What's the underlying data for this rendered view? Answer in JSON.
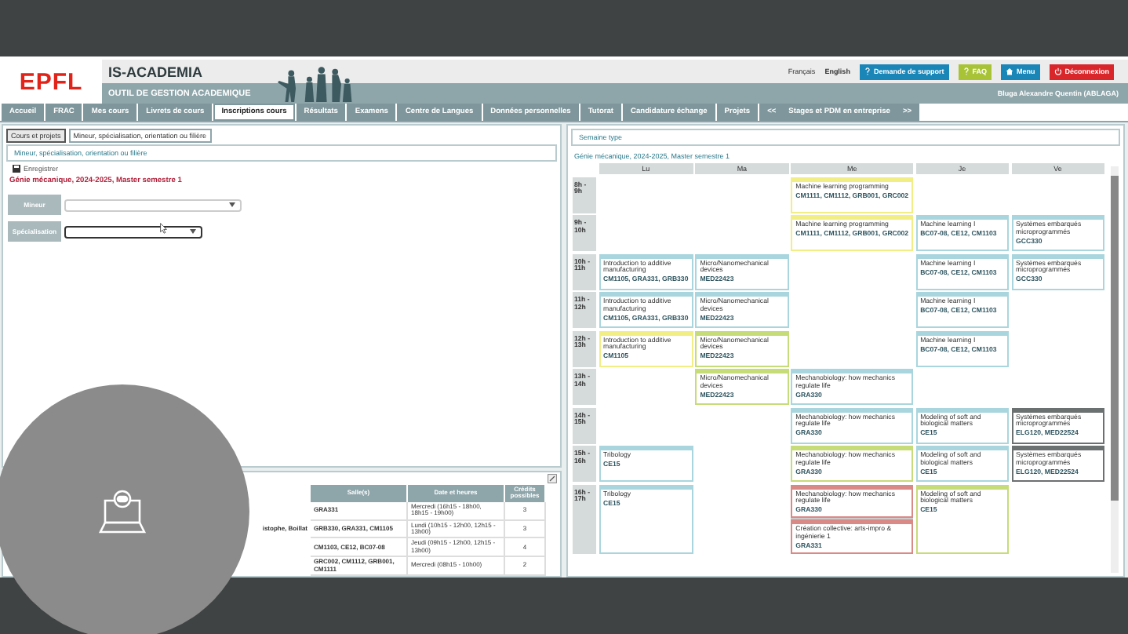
{
  "header": {
    "logo": "EPFL",
    "title": "IS-ACADEMIA",
    "subtitle": "OUTIL DE GESTION ACADEMIQUE",
    "languages": [
      {
        "label": "Français",
        "selected": false
      },
      {
        "label": "English",
        "selected": true
      }
    ],
    "buttons": [
      {
        "label": "Demande de support",
        "kind": "support"
      },
      {
        "label": "FAQ",
        "kind": "faq"
      },
      {
        "label": "Menu",
        "kind": "menu"
      },
      {
        "label": "Déconnexion",
        "kind": "logout"
      }
    ],
    "user": "Bluga Alexandre Quentin (ABLAGA)"
  },
  "main_tabs": [
    {
      "label": "Accueil",
      "selected": false
    },
    {
      "label": "FRAC",
      "selected": false
    },
    {
      "label": "Mes cours",
      "selected": false
    },
    {
      "label": "Livrets de cours",
      "selected": false
    },
    {
      "label": "Inscriptions cours",
      "selected": true
    },
    {
      "label": "Résultats",
      "selected": false
    },
    {
      "label": "Examens",
      "selected": false
    },
    {
      "label": "Centre de Langues",
      "selected": false
    },
    {
      "label": "Données personnelles",
      "selected": false
    },
    {
      "label": "Tutorat",
      "selected": false
    },
    {
      "label": "Candidature échange",
      "selected": false
    },
    {
      "label": "Projets",
      "selected": false
    },
    {
      "label": "Stages et PDM en entreprise",
      "selected": false
    }
  ],
  "tab_scroll": {
    "previous": "<<",
    "next": ">>"
  },
  "left_panel": {
    "sub_tabs": [
      {
        "label": "Cours et projets",
        "selected": false
      },
      {
        "label": "Mineur, spécialisation, orientation ou filière",
        "selected": true
      }
    ],
    "section_title": "Mineur, spécialisation, orientation ou filière",
    "save": "Enregistrer",
    "program": "Génie mécanique, 2024-2025, Master semestre 1",
    "fields": [
      {
        "label": "Mineur",
        "focused": false
      },
      {
        "label": "Spécialisation",
        "focused": true
      }
    ]
  },
  "courses_table": {
    "columns": [
      "Salle(s)",
      "Date et heures",
      "Crédits possibles"
    ],
    "rows": [
      {
        "rooms": "GRA331",
        "schedule": "Mercredi (16h15 - 18h00, 18h15 - 19h00)",
        "credits": "3"
      },
      {
        "column_1": "istophe, Boillat",
        "rooms": "GRB330, GRA331, CM1105",
        "schedule": "Lundi (10h15 - 12h00, 12h15 - 13h00)",
        "credits": "3"
      },
      {
        "rooms": "CM1103, CE12, BC07-08",
        "schedule": "Jeudi (09h15 - 12h00, 12h15 - 13h00)",
        "credits": "4"
      },
      {
        "rooms": "GRC002, CM1112, GRB001, CM1111",
        "schedule": "Mercredi (08h15 - 10h00)",
        "credits": "2"
      }
    ]
  },
  "schedule": {
    "title": "Semaine type",
    "program": "Génie mécanique, 2024-2025, Master semestre 1",
    "days": [
      "Lu",
      "Ma",
      "Me",
      "Je",
      "Ve"
    ],
    "rows": [
      {
        "time": "8h - 9h",
        "slots": [
          {
            "kind": "free"
          },
          {
            "kind": "free"
          },
          {
            "kind": "course",
            "events": [
              {
                "title": "Machine learning programming",
                "rooms": "CM1111, CM1112, GRB001, GRC002",
                "color": "#f2ee86"
              }
            ]
          },
          {
            "kind": "free"
          },
          {
            "kind": "free"
          }
        ]
      },
      {
        "time": "9h - 10h",
        "slots": [
          {
            "kind": "free"
          },
          {
            "kind": "free"
          },
          {
            "kind": "course",
            "events": [
              {
                "title": "Machine learning programming",
                "rooms": "CM1111, CM1112, GRB001, GRC002",
                "color": "#f2ee86"
              }
            ]
          },
          {
            "kind": "course",
            "events": [
              {
                "title": "Machine learning I",
                "rooms": "BC07-08, CE12, CM1103",
                "color": "#a9d6de"
              }
            ]
          },
          {
            "kind": "course",
            "events": [
              {
                "title": "Systèmes embarqués microprogrammés",
                "rooms": "GCC330",
                "color": "#a9d6de"
              }
            ]
          }
        ]
      },
      {
        "time": "10h - 11h",
        "slots": [
          {
            "kind": "course",
            "events": [
              {
                "title": "Introduction to additive manufacturing",
                "rooms": "CM1105, GRA331, GRB330",
                "color": "#a9d6de"
              }
            ]
          },
          {
            "kind": "course",
            "events": [
              {
                "title": "Micro/Nanomechanical devices",
                "rooms": "MED22423",
                "color": "#a9d6de"
              }
            ]
          },
          {
            "kind": "free"
          },
          {
            "kind": "course",
            "events": [
              {
                "title": "Machine learning I",
                "rooms": "BC07-08, CE12, CM1103",
                "color": "#a9d6de"
              }
            ]
          },
          {
            "kind": "course",
            "events": [
              {
                "title": "Systèmes embarqués microprogrammés",
                "rooms": "GCC330",
                "color": "#a9d6de"
              }
            ]
          }
        ]
      },
      {
        "time": "11h - 12h",
        "slots": [
          {
            "kind": "course",
            "events": [
              {
                "title": "Introduction to additive manufacturing",
                "rooms": "CM1105, GRA331, GRB330",
                "color": "#a9d6de"
              }
            ]
          },
          {
            "kind": "course",
            "events": [
              {
                "title": "Micro/Nanomechanical devices",
                "rooms": "MED22423",
                "color": "#a9d6de"
              }
            ]
          },
          {
            "kind": "free"
          },
          {
            "kind": "course",
            "events": [
              {
                "title": "Machine learning I",
                "rooms": "BC07-08, CE12, CM1103",
                "color": "#a9d6de"
              }
            ]
          },
          {
            "kind": "free"
          }
        ]
      },
      {
        "time": "12h - 13h",
        "slots": [
          {
            "kind": "course",
            "events": [
              {
                "title": "Introduction to additive manufacturing",
                "rooms": "CM1105",
                "color": "#f2ee86"
              }
            ]
          },
          {
            "kind": "course",
            "events": [
              {
                "title": "Micro/Nanomechanical devices",
                "rooms": "MED22423",
                "color": "#c6dc78"
              }
            ]
          },
          {
            "kind": "free"
          },
          {
            "kind": "course",
            "events": [
              {
                "title": "Machine learning I",
                "rooms": "BC07-08, CE12, CM1103",
                "color": "#a9d6de"
              }
            ]
          },
          {
            "kind": "free"
          }
        ]
      },
      {
        "time": "13h - 14h",
        "slots": [
          {
            "kind": "free"
          },
          {
            "kind": "course",
            "events": [
              {
                "title": "Micro/Nanomechanical devices",
                "rooms": "MED22423",
                "color": "#c6dc78"
              }
            ]
          },
          {
            "kind": "course",
            "events": [
              {
                "title": "Mechanobiology: how mechanics regulate life",
                "rooms": "GRA330",
                "color": "#a9d6de"
              }
            ]
          },
          {
            "kind": "free"
          },
          {
            "kind": "free"
          }
        ]
      },
      {
        "time": "14h - 15h",
        "slots": [
          {
            "kind": "free"
          },
          {
            "kind": "free"
          },
          {
            "kind": "course",
            "events": [
              {
                "title": "Mechanobiology: how mechanics regulate life",
                "rooms": "GRA330",
                "color": "#a9d6de"
              }
            ]
          },
          {
            "kind": "course",
            "events": [
              {
                "title": "Modeling of soft and biological matters",
                "rooms": "CE15",
                "color": "#a9d6de"
              }
            ]
          },
          {
            "kind": "course",
            "events": [
              {
                "title": "Systèmes embarqués microprogrammés",
                "rooms": "ELG120, MED22524",
                "color": "#6b7071"
              }
            ]
          }
        ]
      },
      {
        "time": "15h - 16h",
        "slots": [
          {
            "kind": "course",
            "events": [
              {
                "title": "Tribology",
                "rooms": "CE15",
                "color": "#a9d6de"
              }
            ]
          },
          {
            "kind": "free"
          },
          {
            "kind": "course",
            "events": [
              {
                "title": "Mechanobiology: how mechanics regulate life",
                "rooms": "GRA330",
                "color": "#c6dc78"
              }
            ]
          },
          {
            "kind": "course",
            "events": [
              {
                "title": "Modeling of soft and biological matters",
                "rooms": "CE15",
                "color": "#a9d6de"
              }
            ]
          },
          {
            "kind": "course",
            "events": [
              {
                "title": "Systèmes embarqués microprogrammés",
                "rooms": "ELG120, MED22524",
                "color": "#6b7071"
              }
            ]
          }
        ]
      },
      {
        "time": "16h - 17h",
        "slots": [
          {
            "kind": "course",
            "events": [
              {
                "title": "Tribology",
                "rooms": "CE15",
                "color": "#a9d6de"
              }
            ]
          },
          {
            "kind": "free"
          },
          {
            "kind": "course",
            "events": [
              {
                "title": "Mechanobiology: how mechanics regulate life",
                "rooms": "GRA330",
                "color": "#d98a86"
              },
              {
                "title": "Création collective: arts-impro & ingénierie 1",
                "rooms": "GRA331",
                "color": "#d98a86"
              }
            ]
          },
          {
            "kind": "course",
            "events": [
              {
                "title": "Modeling of soft and biological matters",
                "rooms": "CE15",
                "color": "#c6dc78"
              }
            ]
          },
          {
            "kind": "free"
          }
        ]
      }
    ]
  }
}
